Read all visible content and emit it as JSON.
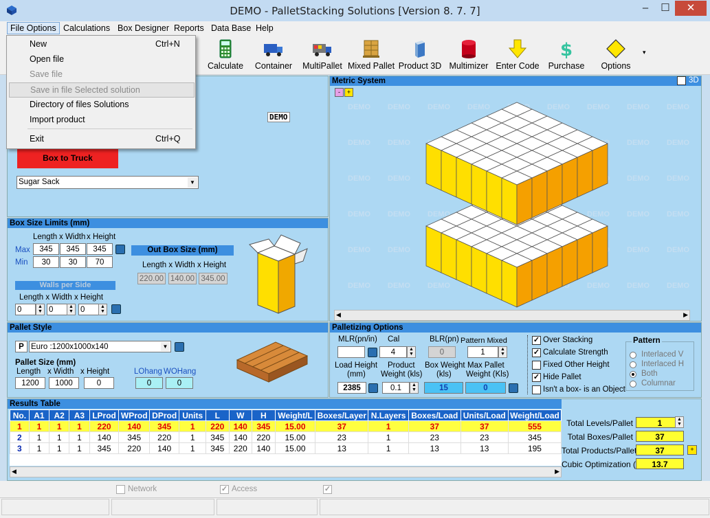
{
  "window": {
    "title": "DEMO - PalletStacking Solutions [Version  8. 7. 7]",
    "minimize": "–",
    "maximize": "☐",
    "close": "✕"
  },
  "menubar": [
    "File Options",
    "Calculations",
    "Box Designer",
    "Reports",
    "Data Base",
    "Help"
  ],
  "file_menu": [
    {
      "label": "New",
      "shortcut": "Ctrl+N",
      "enabled": true
    },
    {
      "label": "Open file",
      "shortcut": "",
      "enabled": true
    },
    {
      "label": "Save file",
      "shortcut": "",
      "enabled": false
    },
    {
      "label": "Save in file Selected solution",
      "shortcut": "",
      "enabled": false
    },
    {
      "label": "Directory of files Solutions",
      "shortcut": "",
      "enabled": true
    },
    {
      "label": "Import product",
      "shortcut": "",
      "enabled": true
    },
    {
      "label": "Exit",
      "shortcut": "Ctrl+Q",
      "enabled": true
    }
  ],
  "toolbar": [
    "Calculate",
    "Container",
    "MultiPallet",
    "Mixed Pallet",
    "Product 3D",
    "Multimizer",
    "Enter Code",
    "Purchase",
    "Options"
  ],
  "top_left": {
    "demo_badge": "DEMO",
    "mode_button": "Box to Truck",
    "product_select": "Sugar  Sack"
  },
  "viewer": {
    "title": "Metric System",
    "toggle_3d": "3D",
    "watermark": "DEMO"
  },
  "box_limits": {
    "title": "Box Size Limits (mm)",
    "col_labels": [
      "Length",
      "x Width",
      "x Height"
    ],
    "max_label": "Max",
    "min_label": "Min",
    "max": [
      "345",
      "345",
      "345"
    ],
    "min": [
      "30",
      "30",
      "70"
    ],
    "walls_label": "Walls per Side",
    "walls": [
      "0",
      "0",
      "0"
    ],
    "out_box_label": "Out Box Size (mm)",
    "out_box": [
      "220.00",
      "140.00",
      "345.00"
    ]
  },
  "pallet_style": {
    "title": "Pallet Style",
    "type_letter": "P",
    "pallet_select": "Euro :1200x1000x140",
    "size_label": "Pallet Size (mm)",
    "size_col_labels": [
      "Length",
      "x  Width",
      "x  Height"
    ],
    "size": [
      "1200",
      "1000",
      "0"
    ],
    "overhang_labels": [
      "LOhang",
      "WOHang"
    ],
    "overhang": [
      "0",
      "0"
    ]
  },
  "palletizing": {
    "title": "Palletizing Options",
    "mlr_label": "MLR(pn/in)",
    "mlr": "",
    "cal_label": "Cal",
    "cal": "4",
    "blr_label": "BLR(pn)",
    "blr": "0",
    "pattern_mixed_label": "Pattern Mixed",
    "pattern_mixed": "1",
    "load_height_label": [
      "Load Height",
      "(mm)"
    ],
    "load_height": "2385",
    "product_weight_label": [
      "Product",
      "Weight (kls)"
    ],
    "product_weight": "0.1",
    "box_weight_label": [
      "Box Weight",
      "(kls)"
    ],
    "box_weight": "15",
    "max_pallet_label": [
      "Max Pallet",
      "Weight (Kls)"
    ],
    "max_pallet": "0",
    "checks": [
      {
        "label": "Over Stacking",
        "checked": true
      },
      {
        "label": "Calculate Strength",
        "checked": true
      },
      {
        "label": "Fixed Other Height",
        "checked": false
      },
      {
        "label": "Hide Pallet",
        "checked": true
      },
      {
        "label": "Isn't a box- is an Object",
        "checked": false
      }
    ],
    "pattern_title": "Pattern",
    "patterns": [
      {
        "label": "Interlaced V",
        "selected": false
      },
      {
        "label": "Interlaced H",
        "selected": false
      },
      {
        "label": "Both",
        "selected": true
      },
      {
        "label": "Columnar",
        "selected": false
      }
    ]
  },
  "results": {
    "title": "Results Table",
    "headers": [
      "No.",
      "A1",
      "A2",
      "A3",
      "LProd",
      "WProd",
      "DProd",
      "Units",
      "L",
      "W",
      "H",
      "Weight/L",
      "Boxes/Layer",
      "N.Layers",
      "Boxes/Load",
      "Units/Load",
      "Weight/Load"
    ],
    "rows": [
      [
        "1",
        "1",
        "1",
        "1",
        "220",
        "140",
        "345",
        "1",
        "220",
        "140",
        "345",
        "15.00",
        "37",
        "1",
        "37",
        "37",
        "555"
      ],
      [
        "2",
        "1",
        "1",
        "1",
        "140",
        "345",
        "220",
        "1",
        "345",
        "140",
        "220",
        "15.00",
        "23",
        "1",
        "23",
        "23",
        "345"
      ],
      [
        "3",
        "1",
        "1",
        "1",
        "345",
        "220",
        "140",
        "1",
        "345",
        "220",
        "140",
        "15.00",
        "13",
        "1",
        "13",
        "13",
        "195"
      ]
    ],
    "summary": [
      {
        "label": "Total Levels/Pallet",
        "value": "1"
      },
      {
        "label": "Total Boxes/Pallet",
        "value": "37"
      },
      {
        "label": "Total Products/Pallet",
        "value": "37"
      },
      {
        "label": "Cubic Optimization (%)",
        "value": "13.7"
      }
    ]
  },
  "status": {
    "network": "Network",
    "access": "Access"
  }
}
